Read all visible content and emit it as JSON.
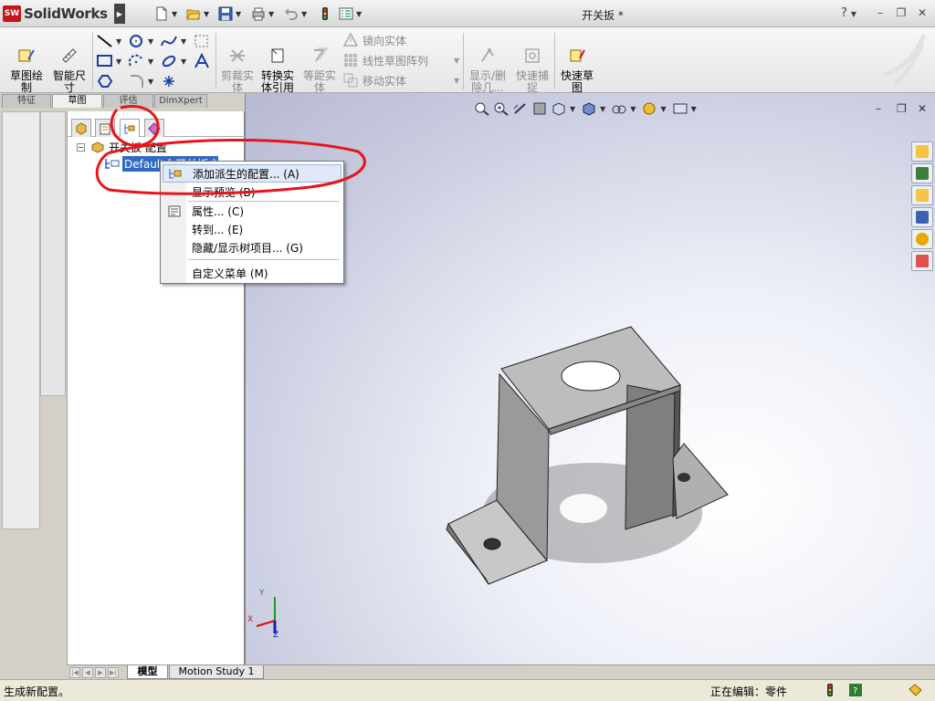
{
  "window": {
    "app_name": "SolidWorks",
    "logo_mark": "SW",
    "document_title": "开关扳 *",
    "help_label": "?",
    "minimize": "–",
    "restore": "❐",
    "close": "✕"
  },
  "ribbon": {
    "sketch_label": "草图绘\n制",
    "smart_dim_label": "智能尺\n寸",
    "trim_label": "剪裁实\n体",
    "convert_label": "转换实\n体引用",
    "offset_label": "等距实\n体",
    "mirror_label": "镜向实体",
    "linear_pattern_label": "线性草图阵列",
    "move_label": "移动实体",
    "display_relations_label": "显示/删\n除几...",
    "quick_snap_label": "快速捕\n捉",
    "rapid_sketch_label": "快速草\n图"
  },
  "command_tabs": [
    "特征",
    "草图",
    "评估",
    "DimXpert"
  ],
  "command_tab_active": "草图",
  "tree": {
    "root_label": "开关扳 配置",
    "child_label": "Default [ 开关扳 ]",
    "expander": "−"
  },
  "context_menu": {
    "items": [
      {
        "label": "添加派生的配置...   (A)",
        "icon": "add-config-icon",
        "highlighted": true
      },
      {
        "label": "显示预览   (B)",
        "icon": "",
        "highlighted": false
      },
      {
        "label": "属性...   (C)",
        "icon": "properties-icon",
        "highlighted": false
      },
      {
        "label": "转到...   (E)",
        "icon": "",
        "highlighted": false
      },
      {
        "label": "隐藏/显示树项目...   (G)",
        "icon": "",
        "highlighted": false
      },
      {
        "label": "自定义菜单 (M)",
        "icon": "",
        "highlighted": false
      }
    ]
  },
  "bottom_tabs": [
    "模型",
    "Motion Study 1"
  ],
  "bottom_tab_active": "模型",
  "status": {
    "message": "生成新配置。",
    "editing": "正在编辑：零件"
  },
  "triad": {
    "x": "X",
    "y": "Y",
    "z": "Z"
  },
  "colors": {
    "selection": "#316ac5",
    "annotation": "#e8141c",
    "brand": "#c4161c"
  }
}
